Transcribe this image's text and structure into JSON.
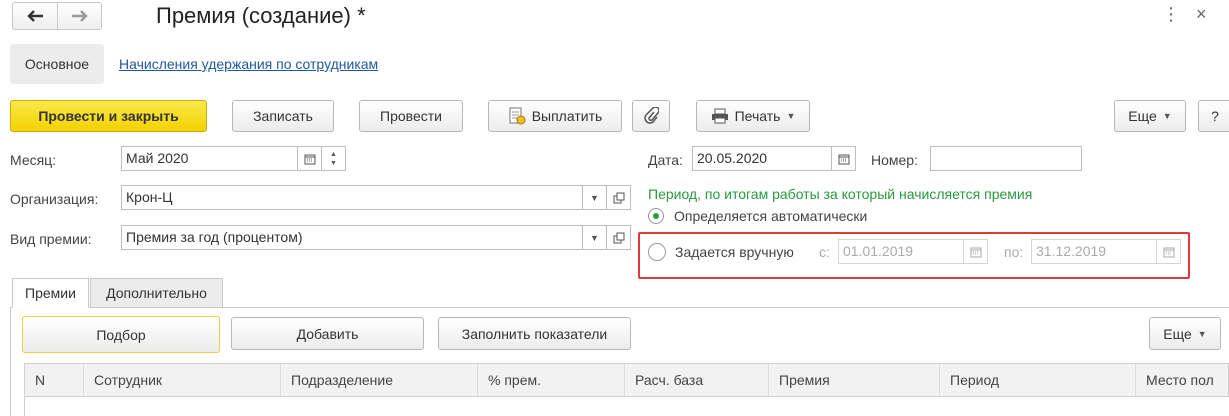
{
  "window": {
    "title": "Премия (создание) *"
  },
  "nav": {
    "back_icon": "arrow-left-icon",
    "forward_icon": "arrow-right-icon"
  },
  "links": {
    "main": "Основное",
    "accruals": "Начисления удержания по сотрудникам"
  },
  "toolbar": {
    "post_close": "Провести и закрыть",
    "save": "Записать",
    "post": "Провести",
    "pay": "Выплатить",
    "print": "Печать",
    "more": "Еще",
    "help": "?"
  },
  "form": {
    "month_label": "Месяц:",
    "month_value": "Май 2020",
    "org_label": "Организация:",
    "org_value": "Крон-Ц",
    "bonus_type_label": "Вид премии:",
    "bonus_type_value": "Премия за год (процентом)",
    "date_label": "Дата:",
    "date_value": "20.05.2020",
    "number_label": "Номер:",
    "number_value": ""
  },
  "period": {
    "title": "Период, по итогам работы за который начисляется премия",
    "auto_label": "Определяется автоматически",
    "manual_label": "Задается вручную",
    "from_label": "с:",
    "from_value": "01.01.2019",
    "to_label": "по:",
    "to_value": "31.12.2019",
    "selected": "auto"
  },
  "tabs": [
    {
      "label": "Премии",
      "active": true
    },
    {
      "label": "Дополнительно",
      "active": false
    }
  ],
  "table_toolbar": {
    "select": "Подбор",
    "add": "Добавить",
    "fill": "Заполнить показатели",
    "more": "Еще"
  },
  "table": {
    "columns": [
      "N",
      "Сотрудник",
      "Подразделение",
      "% прем.",
      "Расч. база",
      "Премия",
      "Период",
      "Место пол"
    ]
  },
  "colors": {
    "accent": "#f3d200",
    "highlight": "#e0393e",
    "period_title": "#2a9a3d",
    "link": "#1f5aa0"
  }
}
